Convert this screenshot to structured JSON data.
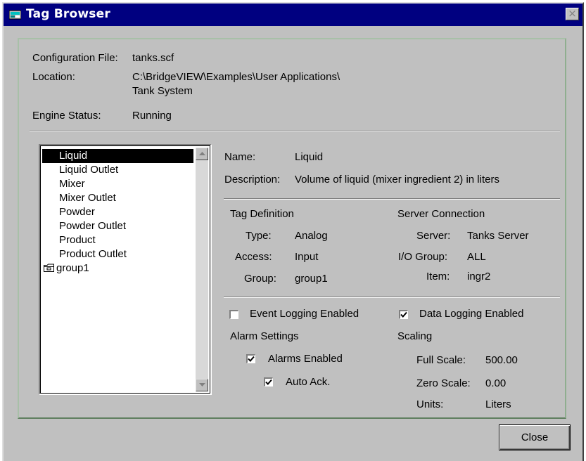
{
  "window": {
    "title": "Tag Browser",
    "close_glyph": "×"
  },
  "header": {
    "config_label": "Configuration File:",
    "config_value": "tanks.scf",
    "location_label": "Location:",
    "location_value_line1": "C:\\BridgeVIEW\\Examples\\User Applications\\",
    "location_value_line2": "Tank System",
    "engine_label": "Engine Status:",
    "engine_value": "Running"
  },
  "tag_list": {
    "items": [
      "Liquid",
      "Liquid Outlet",
      "Mixer",
      "Mixer Outlet",
      "Powder",
      "Powder Outlet",
      "Product",
      "Product Outlet",
      "group1"
    ],
    "selected": "Liquid"
  },
  "details": {
    "name_label": "Name:",
    "name_value": "Liquid",
    "description_label": "Description:",
    "description_value": "Volume of liquid (mixer ingredient 2) in liters"
  },
  "tag_definition": {
    "heading": "Tag Definition",
    "type_label": "Type:",
    "type_value": "Analog",
    "access_label": "Access:",
    "access_value": "Input",
    "group_label": "Group:",
    "group_value": "group1"
  },
  "server_connection": {
    "heading": "Server Connection",
    "server_label": "Server:",
    "server_value": "Tanks Server",
    "io_group_label": "I/O Group:",
    "io_group_value": "ALL",
    "item_label": "Item:",
    "item_value": "ingr2"
  },
  "logging": {
    "event_label": "Event Logging Enabled",
    "event_checked": false,
    "data_label": "Data Logging Enabled",
    "data_checked": true
  },
  "alarm_settings": {
    "heading": "Alarm Settings",
    "alarms_enabled_label": "Alarms Enabled",
    "alarms_enabled_checked": true,
    "auto_ack_label": "Auto Ack.",
    "auto_ack_checked": true
  },
  "scaling": {
    "heading": "Scaling",
    "full_scale_label": "Full Scale:",
    "full_scale_value": "500.00",
    "zero_scale_label": "Zero Scale:",
    "zero_scale_value": "0.00",
    "units_label": "Units:",
    "units_value": "Liters"
  },
  "buttons": {
    "close_label": "Close"
  },
  "icons": {
    "title": "tag-browser-icon",
    "folder": "folder-icon",
    "scroll_up": "scroll-up-arrow-icon",
    "scroll_down": "scroll-down-arrow-icon",
    "check": "checkmark-icon"
  },
  "colors": {
    "titlebar": "#000080",
    "face": "#c0c0c0",
    "panel_border": "#a8c0a8",
    "selection": "#000000"
  }
}
